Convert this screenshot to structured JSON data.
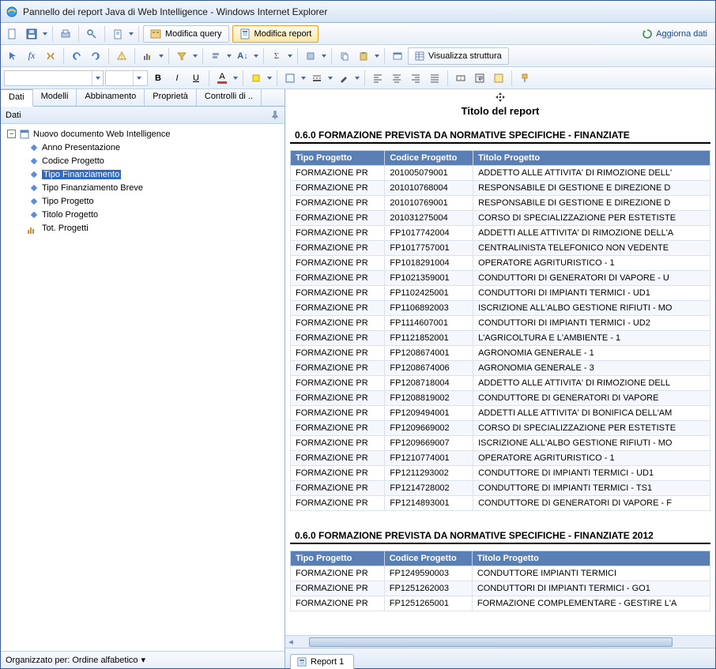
{
  "window": {
    "title": "Pannello dei report Java di Web Intelligence - Windows Internet Explorer"
  },
  "toolbar": {
    "modify_query": "Modifica query",
    "modify_report": "Modifica report",
    "refresh_data": "Aggiorna dati",
    "view_structure": "Visualizza struttura"
  },
  "left": {
    "tabs": [
      "Dati",
      "Modelli",
      "Abbinamento",
      "Proprietà",
      "Controlli di .."
    ],
    "header": "Dati",
    "root": "Nuovo documento Web Intelligence",
    "fields": [
      {
        "label": "Anno Presentazione",
        "type": "dim"
      },
      {
        "label": "Codice Progetto",
        "type": "dim"
      },
      {
        "label": "Tipo Finanziamento",
        "type": "dim",
        "selected": true
      },
      {
        "label": "Tipo Finanziamento Breve",
        "type": "dim"
      },
      {
        "label": "Tipo Progetto",
        "type": "dim"
      },
      {
        "label": "Titolo Progetto",
        "type": "dim"
      },
      {
        "label": "Tot. Progetti",
        "type": "measure"
      }
    ],
    "footer": "Organizzato per: Ordine alfabetico"
  },
  "report": {
    "title": "Titolo del report",
    "tab": "Report 1",
    "sections": [
      {
        "heading": "0.6.0  FORMAZIONE PREVISTA DA NORMATIVE SPECIFICHE - FINANZIATE",
        "columns": [
          "Tipo Progetto",
          "Codice Progetto",
          "Titolo Progetto"
        ],
        "rows": [
          [
            "FORMAZIONE PR",
            "201005079001",
            "ADDETTO ALLE ATTIVITA' DI RIMOZIONE DELL'"
          ],
          [
            "FORMAZIONE PR",
            "201010768004",
            "RESPONSABILE DI GESTIONE E DIREZIONE D"
          ],
          [
            "FORMAZIONE PR",
            "201010769001",
            "RESPONSABILE DI GESTIONE E DIREZIONE D"
          ],
          [
            "FORMAZIONE PR",
            "201031275004",
            "CORSO DI SPECIALIZZAZIONE PER ESTETISTE"
          ],
          [
            "FORMAZIONE PR",
            "FP1017742004",
            "ADDETTI ALLE ATTIVITA' DI RIMOZIONE DELL'A"
          ],
          [
            "FORMAZIONE PR",
            "FP1017757001",
            "CENTRALINISTA TELEFONICO NON VEDENTE"
          ],
          [
            "FORMAZIONE PR",
            "FP1018291004",
            "OPERATORE AGRITURISTICO - 1"
          ],
          [
            "FORMAZIONE PR",
            "FP1021359001",
            "CONDUTTORI DI GENERATORI DI VAPORE - U"
          ],
          [
            "FORMAZIONE PR",
            "FP1102425001",
            "CONDUTTORI DI IMPIANTI TERMICI - UD1"
          ],
          [
            "FORMAZIONE PR",
            "FP1106892003",
            "ISCRIZIONE ALL'ALBO GESTIONE RIFIUTI - MO"
          ],
          [
            "FORMAZIONE PR",
            "FP1114607001",
            "CONDUTTORI DI IMPIANTI TERMICI - UD2"
          ],
          [
            "FORMAZIONE PR",
            "FP1121852001",
            "L'AGRICOLTURA E L'AMBIENTE - 1"
          ],
          [
            "FORMAZIONE PR",
            "FP1208674001",
            "AGRONOMIA GENERALE - 1"
          ],
          [
            "FORMAZIONE PR",
            "FP1208674006",
            "AGRONOMIA GENERALE - 3"
          ],
          [
            "FORMAZIONE PR",
            "FP1208718004",
            "ADDETTO ALLE ATTIVITA' DI RIMOZIONE DELL"
          ],
          [
            "FORMAZIONE PR",
            "FP1208819002",
            "CONDUTTORE DI GENERATORI DI VAPORE"
          ],
          [
            "FORMAZIONE PR",
            "FP1209494001",
            "ADDETTI ALLE ATTIVITA' DI BONIFICA DELL'AM"
          ],
          [
            "FORMAZIONE PR",
            "FP1209669002",
            "CORSO DI SPECIALIZZAZIONE PER ESTETISTE"
          ],
          [
            "FORMAZIONE PR",
            "FP1209669007",
            "ISCRIZIONE ALL'ALBO GESTIONE RIFIUTI - MO"
          ],
          [
            "FORMAZIONE PR",
            "FP1210774001",
            "OPERATORE AGRITURISTICO - 1"
          ],
          [
            "FORMAZIONE PR",
            "FP1211293002",
            "CONDUTTORE DI IMPIANTI TERMICI - UD1"
          ],
          [
            "FORMAZIONE PR",
            "FP1214728002",
            "CONDUTTORE DI IMPIANTI TERMICI - TS1"
          ],
          [
            "FORMAZIONE PR",
            "FP1214893001",
            "CONDUTTORE DI GENERATORI DI VAPORE - F"
          ]
        ]
      },
      {
        "heading": "0.6.0  FORMAZIONE PREVISTA DA NORMATIVE SPECIFICHE - FINANZIATE 2012",
        "columns": [
          "Tipo Progetto",
          "Codice Progetto",
          "Titolo Progetto"
        ],
        "rows": [
          [
            "FORMAZIONE PR",
            "FP1249590003",
            "CONDUTTORE IMPIANTI TERMICI"
          ],
          [
            "FORMAZIONE PR",
            "FP1251262003",
            "CONDUTTORI DI IMPIANTI TERMICI - GO1"
          ],
          [
            "FORMAZIONE PR",
            "FP1251265001",
            "FORMAZIONE COMPLEMENTARE - GESTIRE L'A"
          ]
        ]
      }
    ]
  }
}
